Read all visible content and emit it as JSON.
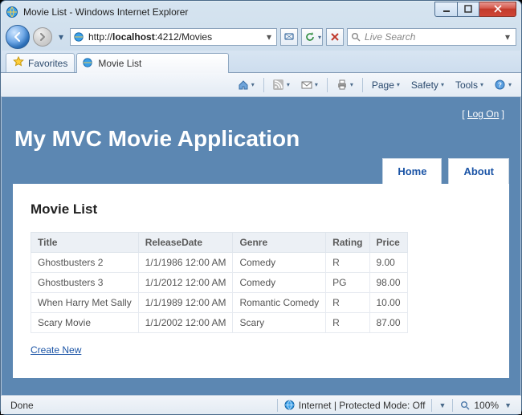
{
  "window": {
    "title": "Movie List - Windows Internet Explorer"
  },
  "address": {
    "prefix": "http://",
    "host": "localhost",
    "port_path": ":4212/Movies"
  },
  "search": {
    "placeholder": "Live Search"
  },
  "favorites": {
    "label": "Favorites"
  },
  "tab": {
    "title": "Movie List"
  },
  "cmd": {
    "page": "Page",
    "safety": "Safety",
    "tools": "Tools"
  },
  "app": {
    "logon": "Log On",
    "title": "My MVC Movie Application",
    "nav_home": "Home",
    "nav_about": "About",
    "heading": "Movie List",
    "create": "Create New",
    "columns": {
      "title": "Title",
      "releaseDate": "ReleaseDate",
      "genre": "Genre",
      "rating": "Rating",
      "price": "Price"
    },
    "rows": [
      {
        "title": "Ghostbusters 2",
        "releaseDate": "1/1/1986 12:00 AM",
        "genre": "Comedy",
        "rating": "R",
        "price": "9.00"
      },
      {
        "title": "Ghostbusters 3",
        "releaseDate": "1/1/2012 12:00 AM",
        "genre": "Comedy",
        "rating": "PG",
        "price": "98.00"
      },
      {
        "title": "When Harry Met Sally",
        "releaseDate": "1/1/1989 12:00 AM",
        "genre": "Romantic Comedy",
        "rating": "R",
        "price": "10.00"
      },
      {
        "title": "Scary Movie",
        "releaseDate": "1/1/2002 12:00 AM",
        "genre": "Scary",
        "rating": "R",
        "price": "87.00"
      }
    ]
  },
  "status": {
    "done": "Done",
    "zone": "Internet | Protected Mode: Off",
    "zoom": "100%"
  }
}
